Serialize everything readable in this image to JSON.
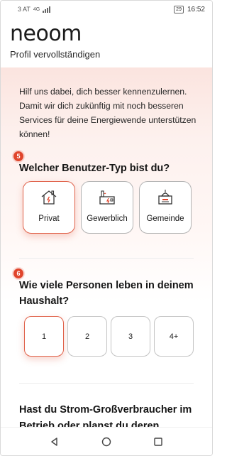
{
  "status_bar": {
    "left": "3 AT",
    "net": "4G",
    "battery": "29",
    "time": "16:52"
  },
  "header": {
    "logo": "neoom",
    "subtitle": "Profil vervollständigen"
  },
  "intro": "Hilf uns dabei, dich besser kennenzulernen. Damit wir dich zukünftig mit noch besseren Services für deine Energiewende unterstützen können!",
  "q1": {
    "badge": "5",
    "title": "Welcher Benutzer-Typ bist du?",
    "options": [
      {
        "label": "Privat",
        "icon": "house-icon",
        "selected": true
      },
      {
        "label": "Gewerblich",
        "icon": "factory-icon",
        "selected": false
      },
      {
        "label": "Gemeinde",
        "icon": "town-hall-icon",
        "selected": false
      }
    ]
  },
  "q2": {
    "badge": "6",
    "title": "Wie viele Personen leben in deinem Haushalt?",
    "options": [
      {
        "label": "1",
        "selected": true
      },
      {
        "label": "2",
        "selected": false
      },
      {
        "label": "3",
        "selected": false
      },
      {
        "label": "4+",
        "selected": false
      }
    ]
  },
  "q3": {
    "title": "Hast du Strom-Großverbraucher im Betrieb oder planst du deren"
  },
  "colors": {
    "accent": "#e0452c",
    "selected_border": "#e06149"
  }
}
